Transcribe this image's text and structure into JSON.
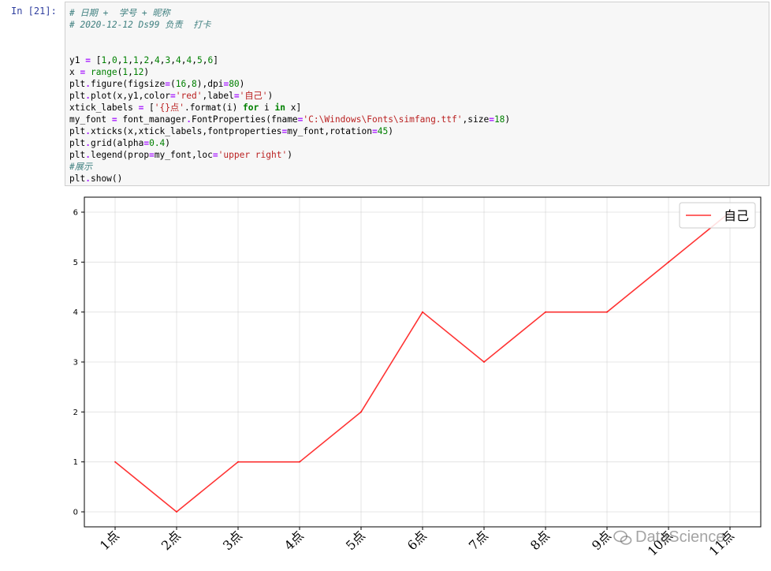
{
  "cell": {
    "prompt": "In  [21]:"
  },
  "code_lines": [
    [
      {
        "t": "# 日期 +  学号 + 昵称",
        "c": "com"
      }
    ],
    [
      {
        "t": "# 2020-12-12 Ds99 负责  打卡",
        "c": "com"
      }
    ],
    [],
    [],
    [
      {
        "t": "y1 "
      },
      {
        "t": "=",
        "c": "op"
      },
      {
        "t": " ["
      },
      {
        "t": "1",
        "c": "num"
      },
      {
        "t": ","
      },
      {
        "t": "0",
        "c": "num"
      },
      {
        "t": ","
      },
      {
        "t": "1",
        "c": "num"
      },
      {
        "t": ","
      },
      {
        "t": "1",
        "c": "num"
      },
      {
        "t": ","
      },
      {
        "t": "2",
        "c": "num"
      },
      {
        "t": ","
      },
      {
        "t": "4",
        "c": "num"
      },
      {
        "t": ","
      },
      {
        "t": "3",
        "c": "num"
      },
      {
        "t": ","
      },
      {
        "t": "4",
        "c": "num"
      },
      {
        "t": ","
      },
      {
        "t": "4",
        "c": "num"
      },
      {
        "t": ","
      },
      {
        "t": "5",
        "c": "num"
      },
      {
        "t": ","
      },
      {
        "t": "6",
        "c": "num"
      },
      {
        "t": "]"
      }
    ],
    [
      {
        "t": "x "
      },
      {
        "t": "=",
        "c": "op"
      },
      {
        "t": " "
      },
      {
        "t": "range",
        "c": "bi"
      },
      {
        "t": "("
      },
      {
        "t": "1",
        "c": "num"
      },
      {
        "t": ","
      },
      {
        "t": "12",
        "c": "num"
      },
      {
        "t": ")"
      }
    ],
    [
      {
        "t": "plt"
      },
      {
        "t": ".",
        "c": "op"
      },
      {
        "t": "figure(figsize"
      },
      {
        "t": "=",
        "c": "op"
      },
      {
        "t": "("
      },
      {
        "t": "16",
        "c": "num"
      },
      {
        "t": ","
      },
      {
        "t": "8",
        "c": "num"
      },
      {
        "t": "),dpi"
      },
      {
        "t": "=",
        "c": "op"
      },
      {
        "t": "80",
        "c": "num"
      },
      {
        "t": ")"
      }
    ],
    [
      {
        "t": "plt"
      },
      {
        "t": ".",
        "c": "op"
      },
      {
        "t": "plot(x,y1,color"
      },
      {
        "t": "=",
        "c": "op"
      },
      {
        "t": "'red'",
        "c": "str"
      },
      {
        "t": ",label"
      },
      {
        "t": "=",
        "c": "op"
      },
      {
        "t": "'自己'",
        "c": "str"
      },
      {
        "t": ")"
      }
    ],
    [
      {
        "t": "xtick_labels "
      },
      {
        "t": "=",
        "c": "op"
      },
      {
        "t": " ["
      },
      {
        "t": "'{}点'",
        "c": "str"
      },
      {
        "t": "."
      },
      {
        "t": "format(i) "
      },
      {
        "t": "for",
        "c": "kw"
      },
      {
        "t": " i "
      },
      {
        "t": "in",
        "c": "kw"
      },
      {
        "t": " x]"
      }
    ],
    [
      {
        "t": "my_font "
      },
      {
        "t": "=",
        "c": "op"
      },
      {
        "t": " font_manager"
      },
      {
        "t": ".",
        "c": "op"
      },
      {
        "t": "FontProperties(fname"
      },
      {
        "t": "=",
        "c": "op"
      },
      {
        "t": "'C:\\Windows\\Fonts\\simfang.ttf'",
        "c": "str"
      },
      {
        "t": ",size"
      },
      {
        "t": "=",
        "c": "op"
      },
      {
        "t": "18",
        "c": "num"
      },
      {
        "t": ")"
      }
    ],
    [
      {
        "t": "plt"
      },
      {
        "t": ".",
        "c": "op"
      },
      {
        "t": "xticks(x,xtick_labels,fontproperties"
      },
      {
        "t": "=",
        "c": "op"
      },
      {
        "t": "my_font,rotation"
      },
      {
        "t": "=",
        "c": "op"
      },
      {
        "t": "45",
        "c": "num"
      },
      {
        "t": ")"
      }
    ],
    [
      {
        "t": "plt"
      },
      {
        "t": ".",
        "c": "op"
      },
      {
        "t": "grid(alpha"
      },
      {
        "t": "=",
        "c": "op"
      },
      {
        "t": "0.4",
        "c": "num"
      },
      {
        "t": ")"
      }
    ],
    [
      {
        "t": "plt"
      },
      {
        "t": ".",
        "c": "op"
      },
      {
        "t": "legend(prop"
      },
      {
        "t": "=",
        "c": "op"
      },
      {
        "t": "my_font,loc"
      },
      {
        "t": "=",
        "c": "op"
      },
      {
        "t": "'upper right'",
        "c": "str"
      },
      {
        "t": ")"
      }
    ],
    [
      {
        "t": "#展示",
        "c": "com"
      }
    ],
    [
      {
        "t": "plt"
      },
      {
        "t": ".",
        "c": "op"
      },
      {
        "t": "show()"
      }
    ]
  ],
  "chart_data": {
    "type": "line",
    "x": [
      1,
      2,
      3,
      4,
      5,
      6,
      7,
      8,
      9,
      10,
      11
    ],
    "categories": [
      "1点",
      "2点",
      "3点",
      "4点",
      "5点",
      "6点",
      "7点",
      "8点",
      "9点",
      "10点",
      "11点"
    ],
    "series": [
      {
        "name": "自己",
        "values": [
          1,
          0,
          1,
          1,
          2,
          4,
          3,
          4,
          4,
          5,
          6
        ],
        "color": "#ff0000"
      }
    ],
    "yticks": [
      "0",
      "1",
      "2",
      "3",
      "4",
      "5",
      "6"
    ],
    "xlim": [
      0.5,
      11.5
    ],
    "ylim": [
      -0.3,
      6.3
    ],
    "grid": true,
    "legend": "top-right"
  },
  "watermark": {
    "text": "DataScience"
  }
}
